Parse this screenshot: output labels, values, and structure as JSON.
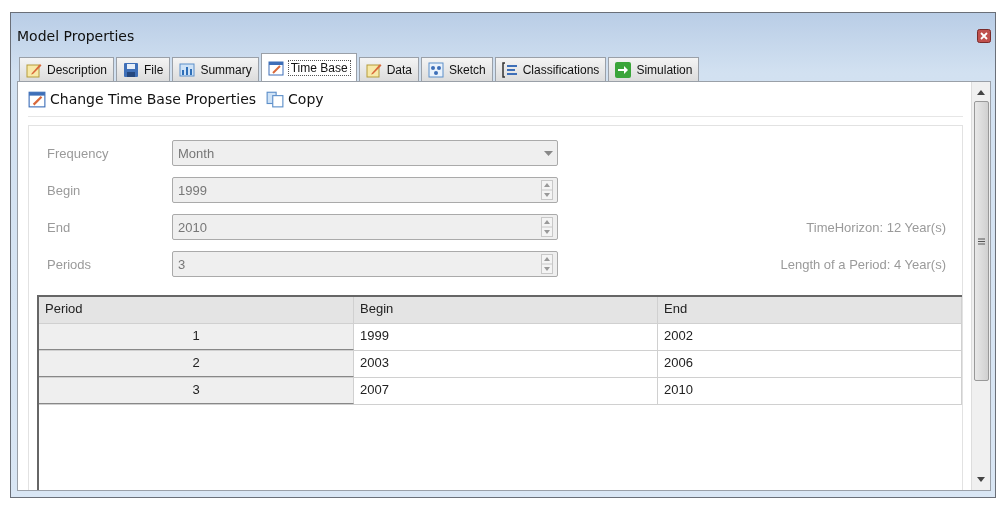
{
  "window": {
    "title": "Model Properties"
  },
  "tabs": [
    {
      "label": "Description",
      "selected": false
    },
    {
      "label": "File",
      "selected": false
    },
    {
      "label": "Summary",
      "selected": false
    },
    {
      "label": "Time Base",
      "selected": true
    },
    {
      "label": "Data",
      "selected": false
    },
    {
      "label": "Sketch",
      "selected": false
    },
    {
      "label": "Classifications",
      "selected": false
    },
    {
      "label": "Simulation",
      "selected": false
    }
  ],
  "toolbar": [
    {
      "label": "Change Time Base Properties"
    },
    {
      "label": "Copy"
    }
  ],
  "fields": [
    {
      "label": "Frequency",
      "kind": "dropdown",
      "value": "Month",
      "disabled": true
    },
    {
      "label": "Begin",
      "kind": "spinner",
      "value": "1999",
      "disabled": true
    },
    {
      "label": "End",
      "kind": "spinner",
      "value": "2010",
      "disabled": true,
      "info": "TimeHorizon: 12 Year(s)"
    },
    {
      "label": "Periods",
      "kind": "spinner",
      "value": "3",
      "disabled": true,
      "info": "Length of a Period: 4 Year(s)"
    }
  ],
  "table": {
    "columns": [
      "Period",
      "Begin",
      "End"
    ],
    "rows": [
      [
        "1",
        "1999",
        "2002"
      ],
      [
        "2",
        "2003",
        "2006"
      ],
      [
        "3",
        "2007",
        "2010"
      ]
    ]
  }
}
